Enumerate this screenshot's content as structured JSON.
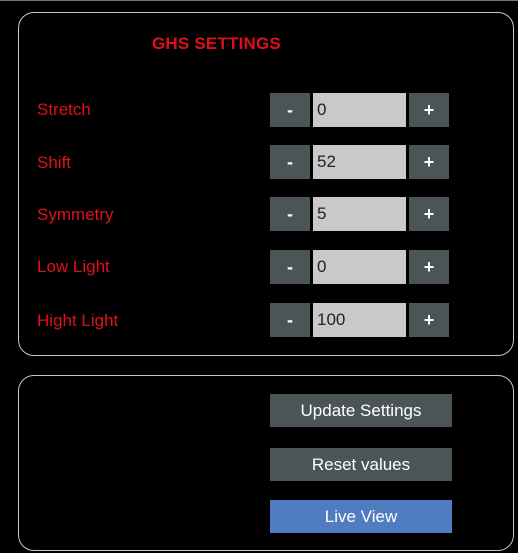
{
  "settings": {
    "title": "GHS SETTINGS",
    "rows": [
      {
        "label": "Stretch",
        "value": "0"
      },
      {
        "label": "Shift",
        "value": "52"
      },
      {
        "label": "Symmetry",
        "value": "5"
      },
      {
        "label": "Low Light",
        "value": "0"
      },
      {
        "label": "Hight Light",
        "value": "100"
      }
    ],
    "minus_label": "-",
    "plus_label": "+"
  },
  "actions": {
    "update_label": "Update Settings",
    "reset_label": "Reset values",
    "live_view_label": "Live View"
  },
  "colors": {
    "label_red": "#e0101a",
    "button_gray": "#4b5557",
    "live_view_blue": "#4f7dbf",
    "field_gray": "#c9c9c9"
  }
}
